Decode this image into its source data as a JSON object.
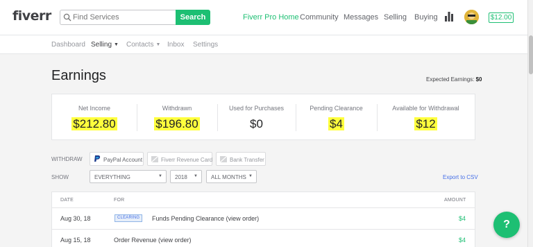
{
  "header": {
    "logo": "fiverr",
    "search_placeholder": "Find Services",
    "search_button": "Search",
    "nav": {
      "pro_home": "Fiverr Pro Home",
      "community": "Community",
      "messages": "Messages",
      "selling": "Selling",
      "buying": "Buying"
    },
    "balance": "$12.00",
    "accent_color": "#1dbf73"
  },
  "subnav": {
    "dashboard": "Dashboard",
    "selling": "Selling",
    "contacts": "Contacts",
    "inbox": "Inbox",
    "settings": "Settings"
  },
  "page": {
    "title": "Earnings",
    "expected_label": "Expected Earnings:",
    "expected_value": "$0"
  },
  "summary": [
    {
      "label": "Net Income",
      "value": "$212.80"
    },
    {
      "label": "Withdrawn",
      "value": "$196.80"
    },
    {
      "label": "Used for Purchases",
      "value": "$0"
    },
    {
      "label": "Pending Clearance",
      "value": "$4"
    },
    {
      "label": "Available for Withdrawal",
      "value": "$12"
    }
  ],
  "withdraw": {
    "label": "WITHDRAW",
    "paypal": "PayPal Account",
    "revenue_card": "Fiverr Revenue Card",
    "bank": "Bank Transfer"
  },
  "filters": {
    "label": "SHOW",
    "type": "EVERYTHING",
    "year": "2018",
    "months": "ALL MONTHS",
    "export": "Export to CSV"
  },
  "table": {
    "headers": {
      "date": "DATE",
      "for": "FOR",
      "amount": "AMOUNT"
    },
    "rows": [
      {
        "date": "Aug 30, 18",
        "badge": "CLEARING",
        "for": "Funds Pending Clearance (view order)",
        "amount": "$4"
      },
      {
        "date": "Aug 15, 18",
        "badge": "",
        "for": "Order Revenue (view order)",
        "amount": "$4"
      }
    ]
  },
  "help_label": "?"
}
